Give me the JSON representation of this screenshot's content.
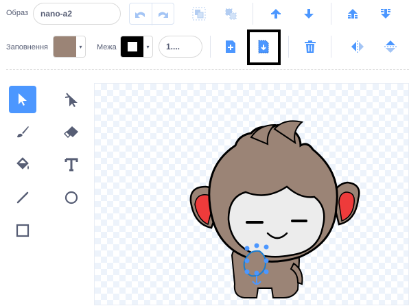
{
  "toolbar": {
    "costume_label": "Образ",
    "costume_name": "nano-a2",
    "fill_label": "Заповнення",
    "fill_color": "#9b8476",
    "outline_label": "Межа",
    "outline_color": "#000000",
    "outline_width": "1...."
  },
  "colors": {
    "accent": "#4c97ff",
    "icon": "#855cd6",
    "highlight": "#000000"
  },
  "tools": [
    "select",
    "reshape",
    "brush",
    "eraser",
    "fill",
    "text",
    "line",
    "circle",
    "rectangle"
  ],
  "selected_tool": "select"
}
